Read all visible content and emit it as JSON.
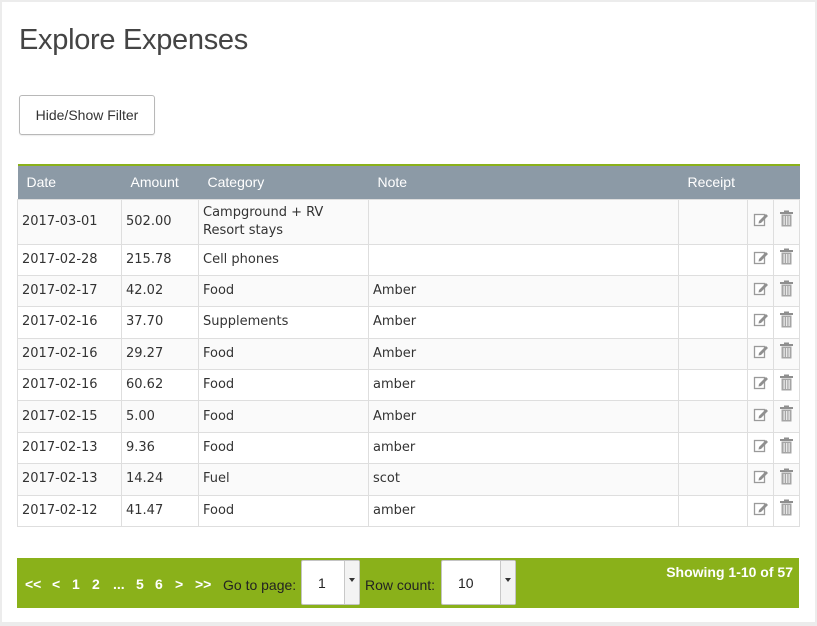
{
  "page": {
    "title": "Explore Expenses"
  },
  "toolbar": {
    "filter_label": "Hide/Show Filter"
  },
  "table": {
    "columns": [
      "Date",
      "Amount",
      "Category",
      "Note",
      "Receipt"
    ],
    "rows": [
      {
        "date": "2017-03-01",
        "amount": "502.00",
        "category": "Campground + RV Resort stays",
        "note": ""
      },
      {
        "date": "2017-02-28",
        "amount": "215.78",
        "category": "Cell phones",
        "note": ""
      },
      {
        "date": "2017-02-17",
        "amount": "42.02",
        "category": "Food",
        "note": "Amber"
      },
      {
        "date": "2017-02-16",
        "amount": "37.70",
        "category": "Supplements",
        "note": "Amber"
      },
      {
        "date": "2017-02-16",
        "amount": "29.27",
        "category": "Food",
        "note": "Amber"
      },
      {
        "date": "2017-02-16",
        "amount": "60.62",
        "category": "Food",
        "note": "amber"
      },
      {
        "date": "2017-02-15",
        "amount": "5.00",
        "category": "Food",
        "note": "Amber"
      },
      {
        "date": "2017-02-13",
        "amount": "9.36",
        "category": "Food",
        "note": "amber"
      },
      {
        "date": "2017-02-13",
        "amount": "14.24",
        "category": "Fuel",
        "note": "scot"
      },
      {
        "date": "2017-02-12",
        "amount": "41.47",
        "category": "Food",
        "note": "amber"
      }
    ],
    "row_actions": [
      "edit-icon",
      "trash-icon"
    ]
  },
  "pager": {
    "first": "<<",
    "prev": "<",
    "pages": [
      "1",
      "2",
      "...",
      "5",
      "6"
    ],
    "next": ">",
    "last": ">>",
    "goto_label": "Go to page:",
    "goto_value": "1",
    "rowcount_label": "Row count:",
    "rowcount_value": "10",
    "showing": "Showing 1-10 of 57"
  },
  "colors": {
    "accent": "#8ab11a",
    "header": "#8c9aa6"
  }
}
